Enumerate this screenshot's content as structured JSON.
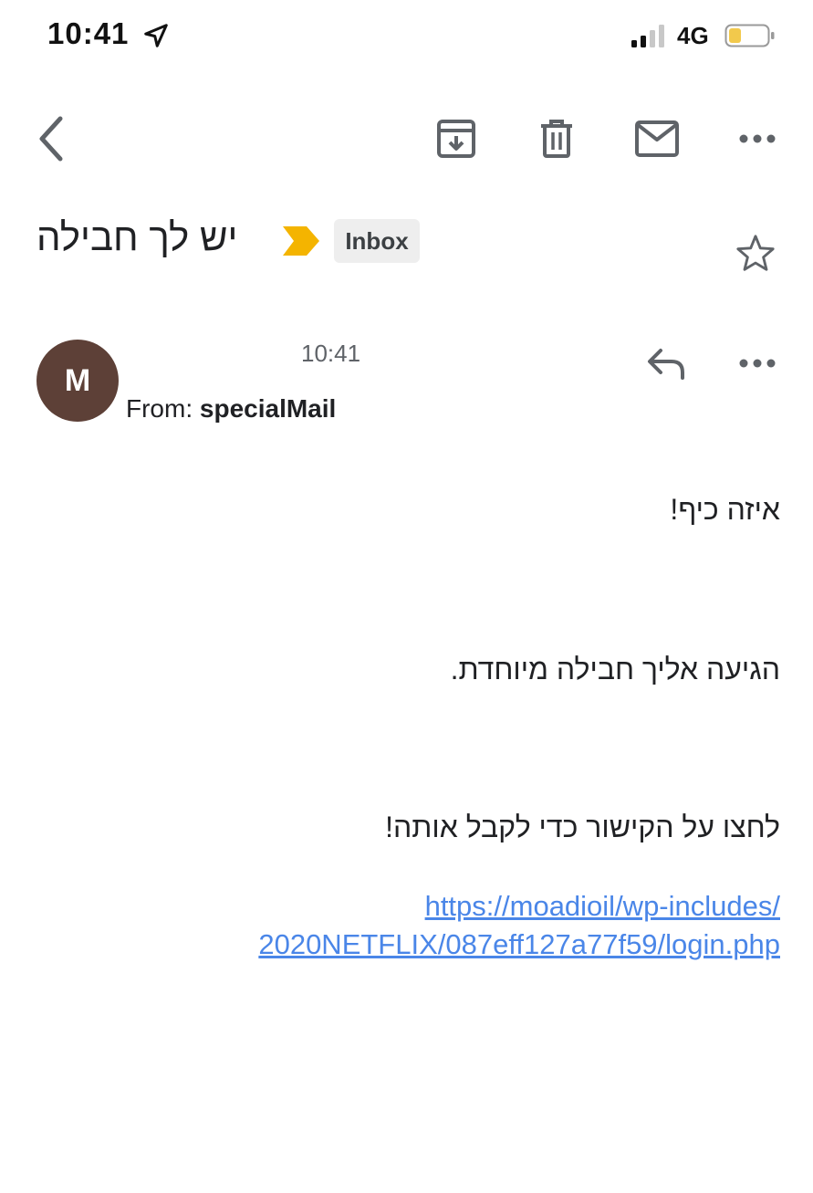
{
  "status_bar": {
    "time": "10:41",
    "network": "4G",
    "icons": [
      "location-arrow-icon",
      "signal-icon",
      "battery-icon"
    ],
    "battery_color": "#f2c94c"
  },
  "toolbar": {
    "icons": [
      "back-chevron-icon",
      "archive-icon",
      "trash-icon",
      "mail-icon",
      "more-horizontal-icon"
    ]
  },
  "email": {
    "subject": "יש לך חבילה",
    "label": "Inbox",
    "importance_color": "#f4b400",
    "avatar_letter": "M",
    "avatar_color": "#5d4037",
    "time": "10:41",
    "from_prefix": "From:",
    "from_name": "specialMail",
    "body": {
      "line1": "איזה כיף!",
      "line2": "הגיעה אליך חבילה מיוחדת.",
      "line3": "לחצו על הקישור כדי לקבל אותה!",
      "link_part1": "https://moadioil/wp-includes/",
      "link_part2": "2020NETFLIX/087eff127a77f59/login.php"
    },
    "link_color": "#4a86e8"
  }
}
